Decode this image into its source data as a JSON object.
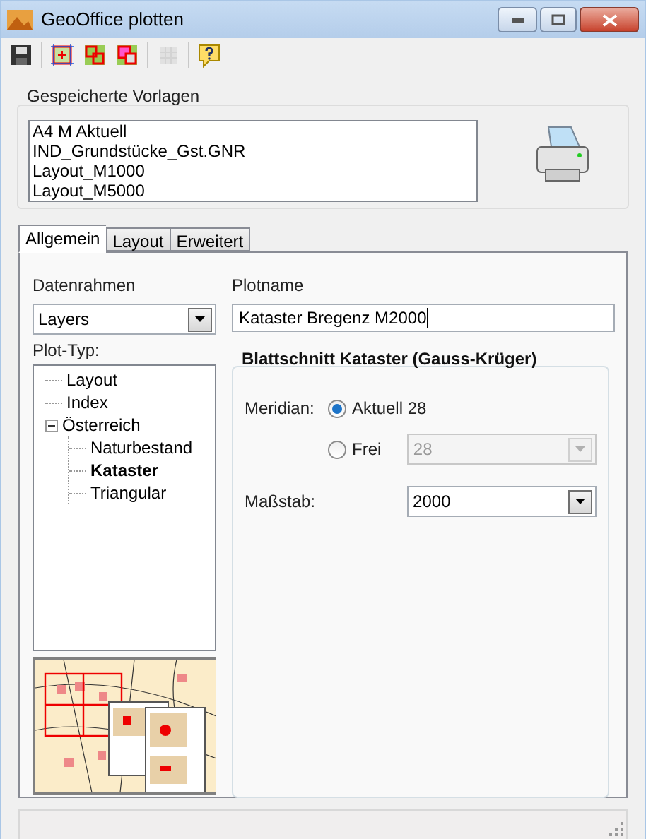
{
  "window": {
    "title": "GeoOffice plotten"
  },
  "toolbar": [
    {
      "kind": "save",
      "disabled": false
    },
    {
      "kind": "frame",
      "disabled": false
    },
    {
      "kind": "add",
      "disabled": false
    },
    {
      "kind": "remove",
      "disabled": false
    },
    {
      "kind": "grid",
      "disabled": true
    },
    {
      "kind": "help",
      "disabled": false
    }
  ],
  "templates": {
    "label": "Gespeicherte Vorlagen",
    "items": [
      "A4 M Aktuell",
      "IND_Grundstücke_Gst.GNR",
      "Layout_M1000",
      "Layout_M5000"
    ]
  },
  "tabs": [
    {
      "label": "Allgemein",
      "selected": true
    },
    {
      "label": "Layout",
      "selected": false
    },
    {
      "label": "Erweitert",
      "selected": false
    }
  ],
  "datenrahmen": {
    "label": "Datenrahmen",
    "value": "Layers"
  },
  "plotname": {
    "label": "Plotname",
    "value": "Kataster Bregenz M2000"
  },
  "plot_typ": {
    "label": "Plot-Typ:",
    "tree": [
      {
        "label": "Layout",
        "selected": false
      },
      {
        "label": "Index",
        "selected": false
      },
      {
        "label": "Österreich",
        "selected": false,
        "expanded": true,
        "children": [
          {
            "label": "Naturbestand",
            "selected": false
          },
          {
            "label": "Kataster",
            "selected": true
          },
          {
            "label": "Triangular",
            "selected": false
          }
        ]
      }
    ]
  },
  "blattschnitt": {
    "title": "Blattschnitt Kataster (Gauss-Krüger)",
    "meridian_label": "Meridian:",
    "radios": [
      {
        "label": "Aktuell 28",
        "selected": true
      },
      {
        "label": "Frei",
        "selected": false
      }
    ],
    "frei_value": "28",
    "frei_disabled": true,
    "massstab_label": "Maßstab:",
    "massstab_value": "2000"
  }
}
